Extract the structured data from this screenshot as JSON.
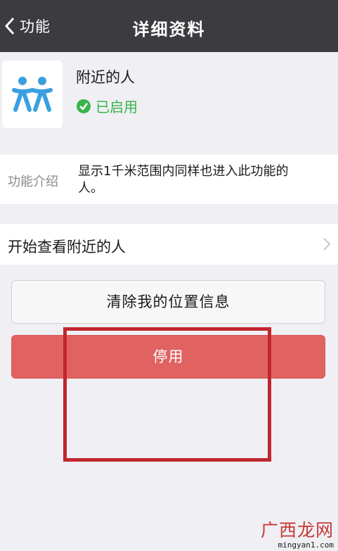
{
  "navbar": {
    "back_label": "功能",
    "title": "详细资料",
    "back_icon": "chevron-left-icon"
  },
  "profile": {
    "icon": "nearby-people-icon",
    "name": "附近的人",
    "status": "已启用",
    "status_icon": "check-circle-icon",
    "status_color": "#3ab54a"
  },
  "intro": {
    "label": "功能介绍",
    "text": "显示1千米范围内同样也进入此功能的人。"
  },
  "start_row": {
    "label": "开始查看附近的人",
    "icon": "chevron-right-icon"
  },
  "buttons": {
    "clear_label": "清除我的位置信息",
    "disable_label": "停用",
    "disable_color": "#e06361"
  },
  "watermark": {
    "logo": "广西龙网",
    "url": "mingyan1.com"
  }
}
